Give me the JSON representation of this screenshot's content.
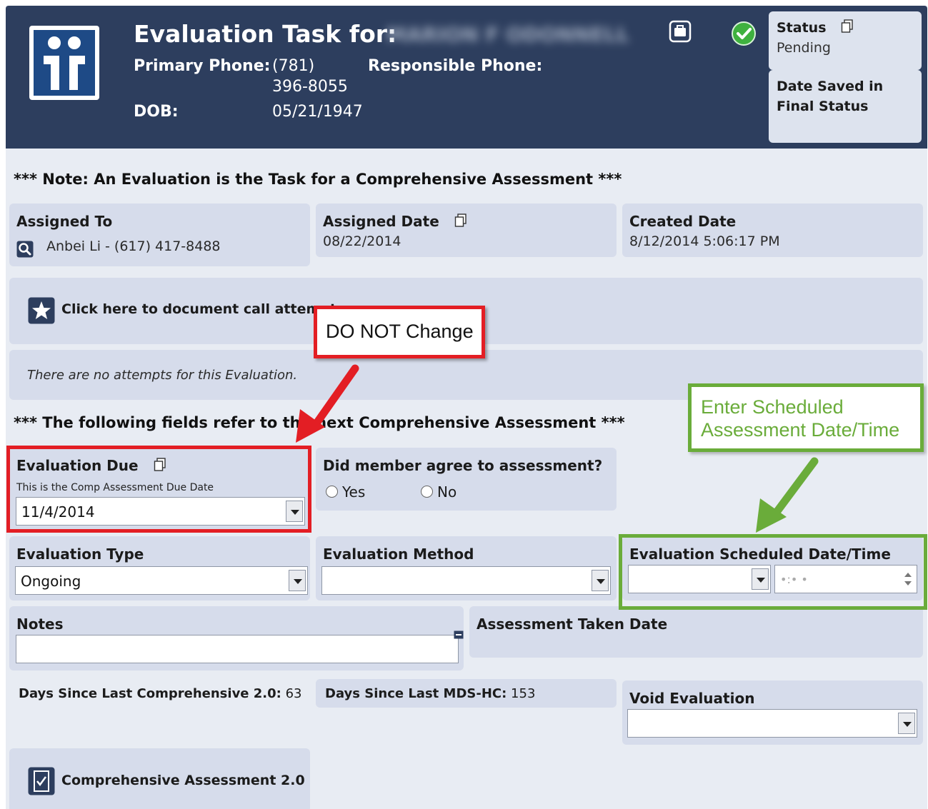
{
  "header": {
    "title": "Evaluation Task for:",
    "member_name": "MARION F ODONNELL",
    "primary_phone_label": "Primary Phone:",
    "primary_phone_line1": "(781)",
    "primary_phone_line2": "396-8055",
    "responsible_phone_label": "Responsible Phone:",
    "dob_label": "DOB:",
    "dob_value": "05/21/1947",
    "status_label": "Status",
    "status_value": "Pending",
    "date_saved_line1": "Date Saved in",
    "date_saved_line2": "Final Status"
  },
  "note_top": "*** Note: An Evaluation is the Task for a Comprehensive Assessment ***",
  "assigned_to": {
    "label": "Assigned To",
    "value": "Anbei Li -  (617) 417-8488"
  },
  "assigned_date": {
    "label": "Assigned Date",
    "value": "08/22/2014"
  },
  "created_date": {
    "label": "Created Date",
    "value": "8/12/2014 5:06:17 PM"
  },
  "call_attempts_link": "Click here to document call attempts",
  "no_attempts_text": "There are no attempts for this Evaluation.",
  "note_fields": "*** The following fields refer to the next Comprehensive Assessment ***",
  "evaluation_due": {
    "label": "Evaluation Due",
    "sublabel": "This is the Comp Assessment Due Date",
    "value": "11/4/2014"
  },
  "member_agree": {
    "label": "Did member agree to assessment?",
    "yes": "Yes",
    "no": "No"
  },
  "evaluation_type": {
    "label": "Evaluation Type",
    "value": "Ongoing"
  },
  "evaluation_method": {
    "label": "Evaluation Method",
    "value": ""
  },
  "evaluation_scheduled": {
    "label": "Evaluation Scheduled Date/Time",
    "time_placeholder": "•:• •"
  },
  "notes": {
    "label": "Notes"
  },
  "assessment_taken": {
    "label": "Assessment Taken Date"
  },
  "days_comp": {
    "label": "Days Since Last Comprehensive 2.0:",
    "value": "63"
  },
  "days_mds": {
    "label": "Days Since Last MDS-HC:",
    "value": "153"
  },
  "void_evaluation": {
    "label": "Void Evaluation"
  },
  "comp_assessment_link": "Comprehensive Assessment 2.0",
  "annotations": {
    "do_not_change": "DO NOT Change",
    "enter_scheduled_line1": "Enter Scheduled",
    "enter_scheduled_line2": "Assessment Date/Time"
  },
  "colors": {
    "header_bg": "#2d3e5e",
    "panel_bg": "#d6dceb",
    "red": "#e31e24",
    "green": "#6aac3a"
  }
}
